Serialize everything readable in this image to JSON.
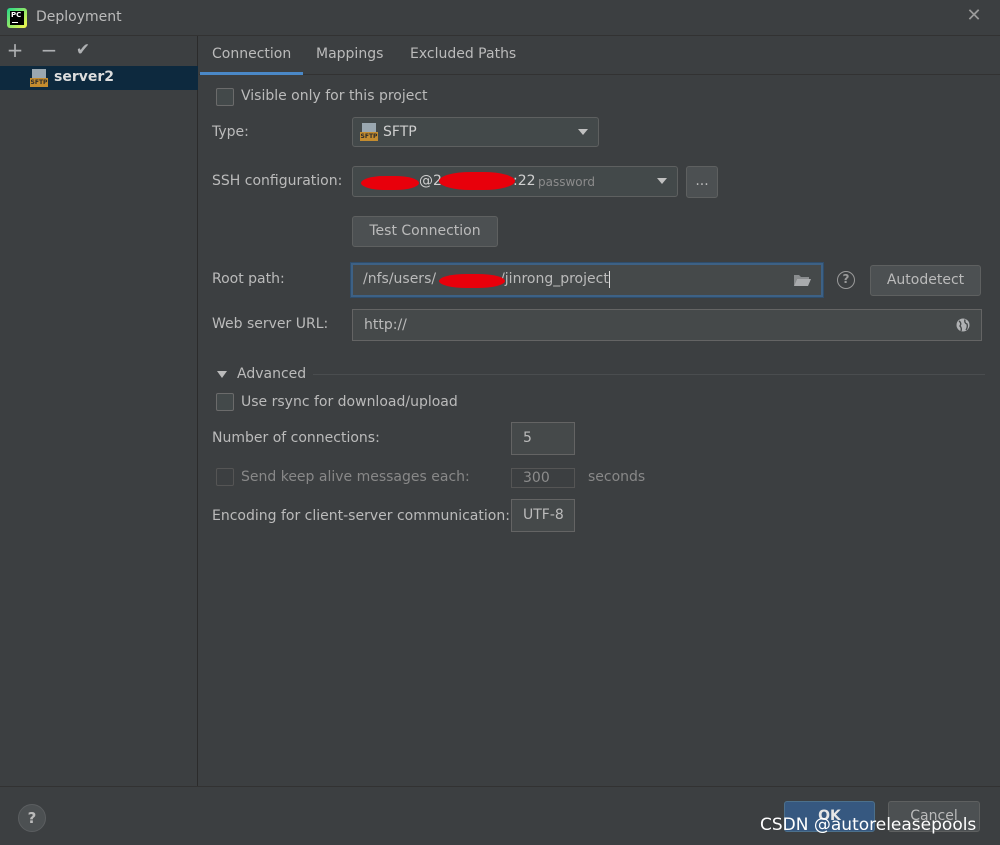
{
  "window": {
    "title": "Deployment",
    "app_icon_text": "PC"
  },
  "sidebar": {
    "add_label": "+",
    "remove_label": "−",
    "apply_label": "✔",
    "server_name": "server2",
    "server_icon_text": "SFTP"
  },
  "tabs": [
    {
      "label": "Connection",
      "active": true
    },
    {
      "label": "Mappings",
      "active": false
    },
    {
      "label": "Excluded Paths",
      "active": false
    }
  ],
  "connection": {
    "visible_only_label": "Visible only for this project",
    "visible_only_checked": false,
    "type_label": "Type:",
    "type_value": "SFTP",
    "type_icon_text": "SFTP",
    "ssh_label": "SSH configuration:",
    "ssh_value_user_fragment": "@2",
    "ssh_value_port": ":22",
    "ssh_value_auth": "password",
    "ssh_browse_label": "...",
    "test_connection_label": "Test Connection",
    "root_path_label": "Root path:",
    "root_path_prefix": "/nfs/users/",
    "root_path_suffix": "/jinrong_project",
    "autodetect_label": "Autodetect",
    "help_label": "?",
    "web_server_url_label": "Web server URL:",
    "web_server_url_value": "http://"
  },
  "advanced": {
    "section_label": "Advanced",
    "rsync_label": "Use rsync for download/upload",
    "rsync_checked": false,
    "num_connections_label": "Number of connections:",
    "num_connections_value": "5",
    "keep_alive_label": "Send keep alive messages each:",
    "keep_alive_value": "300",
    "keep_alive_unit": "seconds",
    "encoding_label": "Encoding for client-server communication:",
    "encoding_value": "UTF-8"
  },
  "footer": {
    "help_label": "?",
    "ok_label": "OK",
    "cancel_label": "Cancel",
    "watermark": "CSDN @autoreleasepools"
  },
  "colors": {
    "background": "#3c3f41",
    "selection": "#0d293e",
    "accent": "#4a88c7",
    "ok_button": "#365880",
    "redaction": "#e8000b"
  }
}
